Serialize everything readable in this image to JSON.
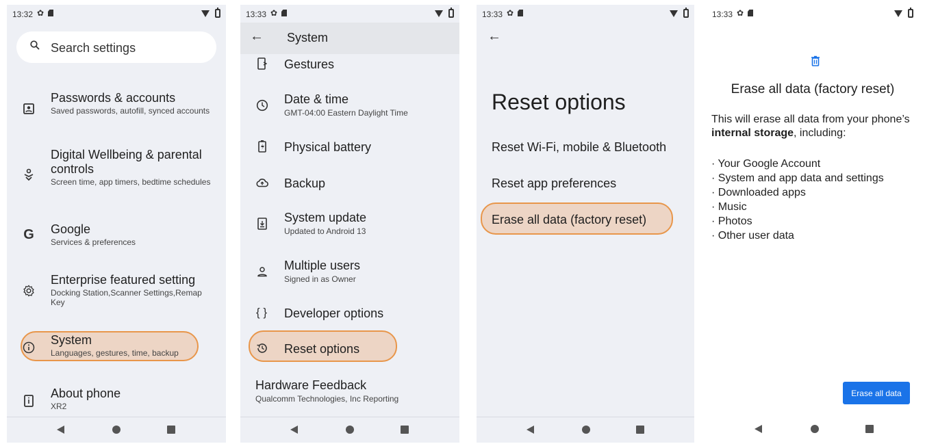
{
  "colors": {
    "accent": "#1a73e8",
    "highlight_border": "#e8964a",
    "highlight_fill": "#ecb48c",
    "screen_bg": "#eef0f5"
  },
  "screen1": {
    "status_time": "13:32",
    "search_placeholder": "Search settings",
    "items": [
      {
        "icon": "account-box-icon",
        "title": "Passwords & accounts",
        "subtitle": "Saved passwords, autofill, synced accounts"
      },
      {
        "icon": "wellbeing-icon",
        "title": "Digital Wellbeing & parental controls",
        "subtitle": "Screen time, app timers, bedtime schedules"
      },
      {
        "icon": "google-icon",
        "title": "Google",
        "subtitle": "Services & preferences"
      },
      {
        "icon": "gear-icon",
        "title": "Enterprise featured setting",
        "subtitle": "Docking Station,Scanner Settings,Remap Key"
      },
      {
        "icon": "info-icon",
        "title": "System",
        "subtitle": "Languages, gestures, time, backup"
      },
      {
        "icon": "phone-info-icon",
        "title": "About phone",
        "subtitle": "XR2"
      }
    ]
  },
  "screen2": {
    "status_time": "13:33",
    "title": "System",
    "items": [
      {
        "icon": "gestures-icon",
        "title": "Gestures",
        "subtitle": ""
      },
      {
        "icon": "clock-icon",
        "title": "Date & time",
        "subtitle": "GMT-04:00 Eastern Daylight Time"
      },
      {
        "icon": "battery-icon",
        "title": "Physical battery",
        "subtitle": ""
      },
      {
        "icon": "cloud-upload-icon",
        "title": "Backup",
        "subtitle": ""
      },
      {
        "icon": "system-update-icon",
        "title": "System update",
        "subtitle": "Updated to Android 13"
      },
      {
        "icon": "person-icon",
        "title": "Multiple users",
        "subtitle": "Signed in as Owner"
      },
      {
        "icon": "braces-icon",
        "title": "Developer options",
        "subtitle": ""
      },
      {
        "icon": "history-icon",
        "title": "Reset options",
        "subtitle": ""
      }
    ],
    "hardware_feedback": {
      "title": "Hardware Feedback",
      "subtitle": "Qualcomm Technologies, Inc Reporting"
    }
  },
  "screen3": {
    "status_time": "13:33",
    "title": "Reset options",
    "items": [
      "Reset Wi-Fi, mobile & Bluetooth",
      "Reset app preferences",
      "Erase all data (factory reset)"
    ]
  },
  "screen4": {
    "status_time": "13:33",
    "title": "Erase all data (factory reset)",
    "intro_before": "This will erase all data from your phone’s ",
    "intro_bold": "internal storage",
    "intro_after": ", including:",
    "bullets": [
      "Your Google Account",
      "System and app data and settings",
      "Downloaded apps",
      "Music",
      "Photos",
      "Other user data"
    ],
    "button_label": "Erase all data"
  }
}
